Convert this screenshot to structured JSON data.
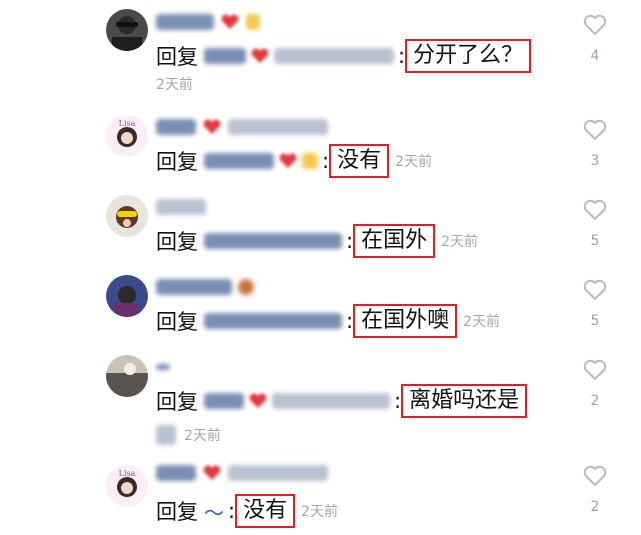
{
  "reply_prefix": "回复",
  "comments": [
    {
      "reply_word": "回复",
      "boxed_text": "分开了么？",
      "time": "2天前",
      "likes": "4"
    },
    {
      "reply_word": "回复",
      "boxed_text": "没有",
      "time": "2天前",
      "likes": "3"
    },
    {
      "reply_word": "回复",
      "boxed_text": "在国外",
      "time": "2天前",
      "likes": "5"
    },
    {
      "reply_word": "回复",
      "boxed_text": "在国外噢",
      "time": "2天前",
      "likes": "5"
    },
    {
      "reply_word": "回复",
      "boxed_text": "离婚吗还是",
      "time": "2天前",
      "likes": "2"
    },
    {
      "reply_word": "回复",
      "mention": "～",
      "boxed_text": "没有",
      "time": "2天前",
      "likes": "2"
    }
  ],
  "avatar_text": "Lisa",
  "colors": {
    "highlight_border": "#e11d2a",
    "meta_gray": "#a3a7ad",
    "heart_red": "#e03a3e"
  }
}
